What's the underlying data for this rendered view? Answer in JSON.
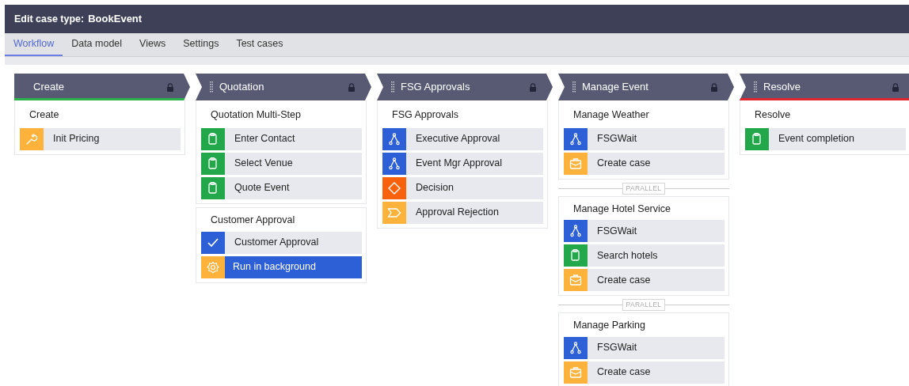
{
  "window": {
    "title_label": "Edit case type:",
    "title": "BookEvent"
  },
  "tabs": [
    {
      "label": "Workflow",
      "selected": true
    },
    {
      "label": "Data model",
      "selected": false
    },
    {
      "label": "Views",
      "selected": false
    },
    {
      "label": "Settings",
      "selected": false
    },
    {
      "label": "Test cases",
      "selected": false
    }
  ],
  "stages": [
    {
      "name": "Create",
      "draggable": false,
      "locked": true,
      "color": "#2bb24c",
      "processes": [
        {
          "name": "Create",
          "parallel": false,
          "steps": [
            {
              "kind": "automation",
              "label": "Init Pricing",
              "selected": false
            }
          ]
        }
      ]
    },
    {
      "name": "Quotation",
      "draggable": true,
      "locked": true,
      "processes": [
        {
          "name": "Quotation Multi-Step",
          "parallel": false,
          "steps": [
            {
              "kind": "assignment",
              "label": "Enter Contact",
              "selected": false
            },
            {
              "kind": "assignment",
              "label": "Select Venue",
              "selected": false
            },
            {
              "kind": "assignment",
              "label": "Quote Event",
              "selected": false
            }
          ]
        },
        {
          "name": "Customer Approval",
          "parallel": false,
          "steps": [
            {
              "kind": "approval",
              "label": "Customer Approval",
              "selected": false
            },
            {
              "kind": "background",
              "label": "Run in background",
              "selected": true
            }
          ]
        }
      ]
    },
    {
      "name": "FSG Approvals",
      "draggable": true,
      "locked": true,
      "processes": [
        {
          "name": "FSG Approvals",
          "parallel": false,
          "steps": [
            {
              "kind": "subprocess",
              "label": "Executive Approval",
              "selected": false
            },
            {
              "kind": "subprocess",
              "label": "Event Mgr Approval",
              "selected": false
            },
            {
              "kind": "decision",
              "label": "Decision",
              "selected": false
            },
            {
              "kind": "change_stage",
              "label": "Approval Rejection",
              "selected": false
            }
          ]
        }
      ]
    },
    {
      "name": "Manage Event",
      "draggable": true,
      "locked": true,
      "processes": [
        {
          "name": "Manage Weather",
          "parallel": false,
          "steps": [
            {
              "kind": "subprocess",
              "label": "FSGWait",
              "selected": false
            },
            {
              "kind": "create_case",
              "label": "Create case",
              "selected": false
            }
          ]
        },
        {
          "name": "Manage Hotel Service",
          "parallel": true,
          "parallel_label": "PARALLEL",
          "steps": [
            {
              "kind": "subprocess",
              "label": "FSGWait",
              "selected": false
            },
            {
              "kind": "assignment",
              "label": "Search hotels",
              "selected": false
            },
            {
              "kind": "create_case",
              "label": "Create case",
              "selected": false
            }
          ]
        },
        {
          "name": "Manage Parking",
          "parallel": true,
          "parallel_label": "PARALLEL",
          "steps": [
            {
              "kind": "subprocess",
              "label": "FSGWait",
              "selected": false
            },
            {
              "kind": "create_case",
              "label": "Create case",
              "selected": false
            }
          ]
        }
      ]
    },
    {
      "name": "Resolve",
      "draggable": true,
      "locked": true,
      "color": "#e0262f",
      "processes": [
        {
          "name": "Resolve",
          "parallel": false,
          "steps": [
            {
              "kind": "assignment",
              "label": "Event completion",
              "selected": false
            }
          ]
        }
      ]
    }
  ]
}
